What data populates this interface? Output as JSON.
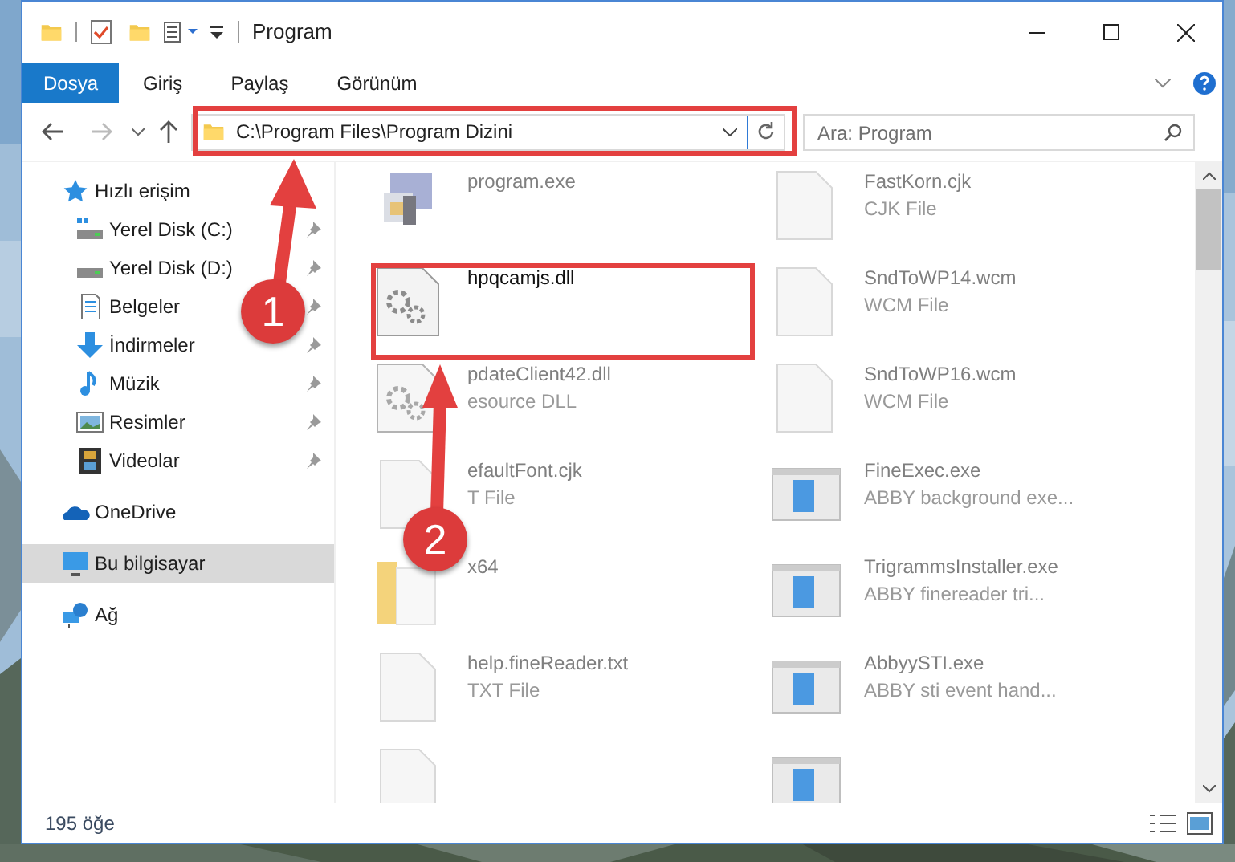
{
  "window": {
    "title": "Program"
  },
  "ribbon_tabs": [
    {
      "label": "Dosya",
      "selected": true
    },
    {
      "label": "Giriş",
      "selected": false
    },
    {
      "label": "Paylaş",
      "selected": false
    },
    {
      "label": "Görünüm",
      "selected": false
    }
  ],
  "address_bar": {
    "path": "C:\\Program Files\\Program Dizini"
  },
  "search": {
    "placeholder": "Ara: Program"
  },
  "sidebar": {
    "items": [
      {
        "label": "Hızlı erişim",
        "kind": "quick-access",
        "selected": false,
        "children": [
          {
            "label": "Yerel Disk (C:)",
            "kind": "system-drive",
            "pinned": true,
            "selected": false
          },
          {
            "label": "Yerel Disk (D:)",
            "kind": "drive",
            "pinned": true,
            "selected": false
          },
          {
            "label": "Belgeler",
            "kind": "documents",
            "pinned": true,
            "selected": false
          },
          {
            "label": "İndirmeler",
            "kind": "downloads",
            "pinned": true,
            "selected": false
          },
          {
            "label": "Müzik",
            "kind": "music",
            "pinned": true,
            "selected": false
          },
          {
            "label": "Resimler",
            "kind": "pictures",
            "pinned": true,
            "selected": false
          },
          {
            "label": "Videolar",
            "kind": "videos",
            "pinned": true,
            "selected": false
          }
        ]
      },
      {
        "label": "OneDrive",
        "kind": "cloud",
        "selected": false
      },
      {
        "label": "Bu bilgisayar",
        "kind": "computer",
        "selected": true
      },
      {
        "label": "Ağ",
        "kind": "network",
        "selected": false
      }
    ]
  },
  "files": [
    {
      "name": "program.exe",
      "kind": "installer",
      "blurred": true
    },
    {
      "name": "FastKorn.cjk",
      "type": "CJK File",
      "kind": "blank",
      "blurred": true
    },
    {
      "name": "hpqcamjs.dll",
      "kind": "dll",
      "blurred": false
    },
    {
      "name": "SndToWP14.wcm",
      "type": "WCM File",
      "kind": "blank",
      "blurred": true
    },
    {
      "name": "pdateClient42.dll",
      "type": "esource DLL",
      "kind": "dll",
      "blurred": true
    },
    {
      "name": "SndToWP16.wcm",
      "type": "WCM File",
      "kind": "blank",
      "blurred": true
    },
    {
      "name": "efaultFont.cjk",
      "type": "T File",
      "kind": "blank",
      "blurred": true
    },
    {
      "name": "FineExec.exe",
      "type": "ABBY background exe...",
      "kind": "app",
      "blurred": true
    },
    {
      "name": "x64",
      "kind": "folder",
      "blurred": true
    },
    {
      "name": "TrigrammsInstaller.exe",
      "type": "ABBY finereader tri...",
      "kind": "app",
      "blurred": true
    },
    {
      "name": "help.fineReader.txt",
      "type": "TXT File",
      "kind": "blank",
      "blurred": true
    },
    {
      "name": "AbbyySTI.exe",
      "type": "ABBY sti event hand...",
      "kind": "app",
      "blurred": true
    },
    {
      "kind": "blank",
      "blurred": true
    },
    {
      "kind": "app",
      "blurred": true
    }
  ],
  "status_bar": {
    "item_count": "195 öğe"
  },
  "annotations": [
    {
      "label": "1"
    },
    {
      "label": "2"
    }
  ]
}
